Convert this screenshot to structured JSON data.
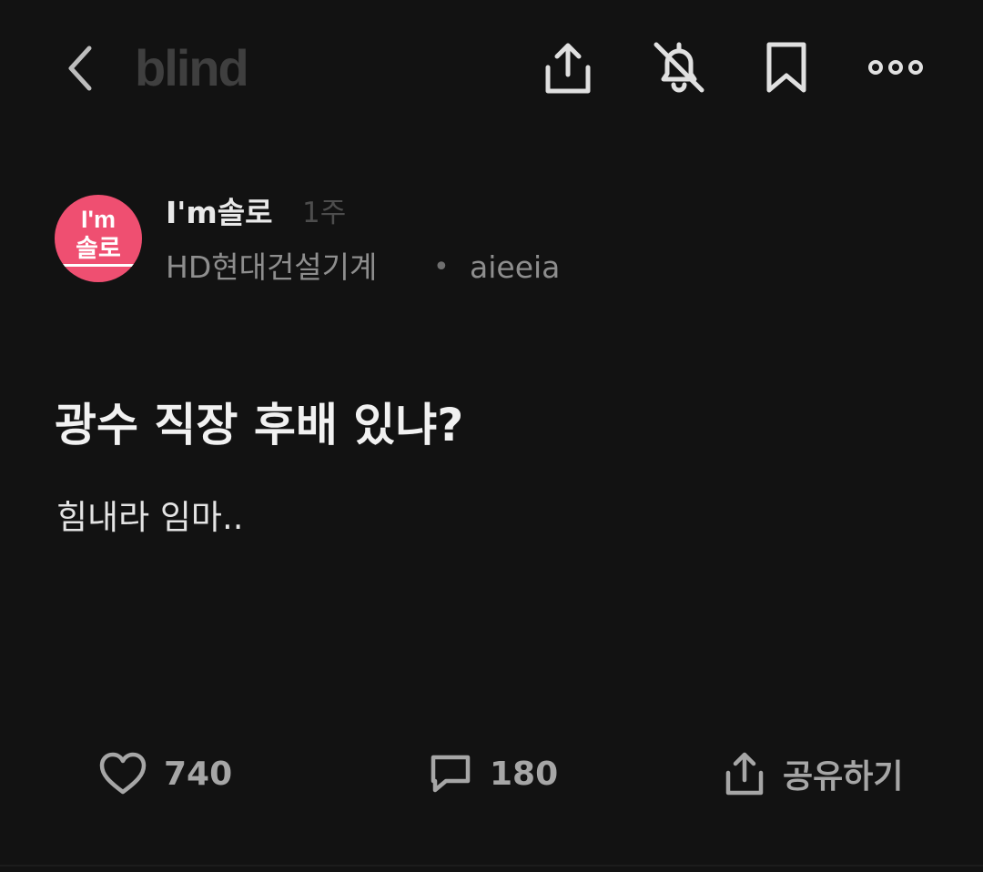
{
  "header": {
    "back_icon": "chevron-left-icon",
    "logo": "blind",
    "actions": [
      "share-icon",
      "bell-off-icon",
      "bookmark-icon",
      "more-icon"
    ]
  },
  "author": {
    "avatar_line1": "I'm",
    "avatar_line2": "솔로",
    "avatar_color": "#ef4f71",
    "name": "I'm솔로",
    "time": "1주",
    "company": "HD현대건설기계",
    "separator": "•",
    "nickname": "aieeia"
  },
  "post": {
    "title": "광수 직장 후배 있냐?",
    "body": "힘내라 임마.."
  },
  "footer": {
    "like_count": "740",
    "comment_count": "180",
    "share_label": "공유하기"
  }
}
